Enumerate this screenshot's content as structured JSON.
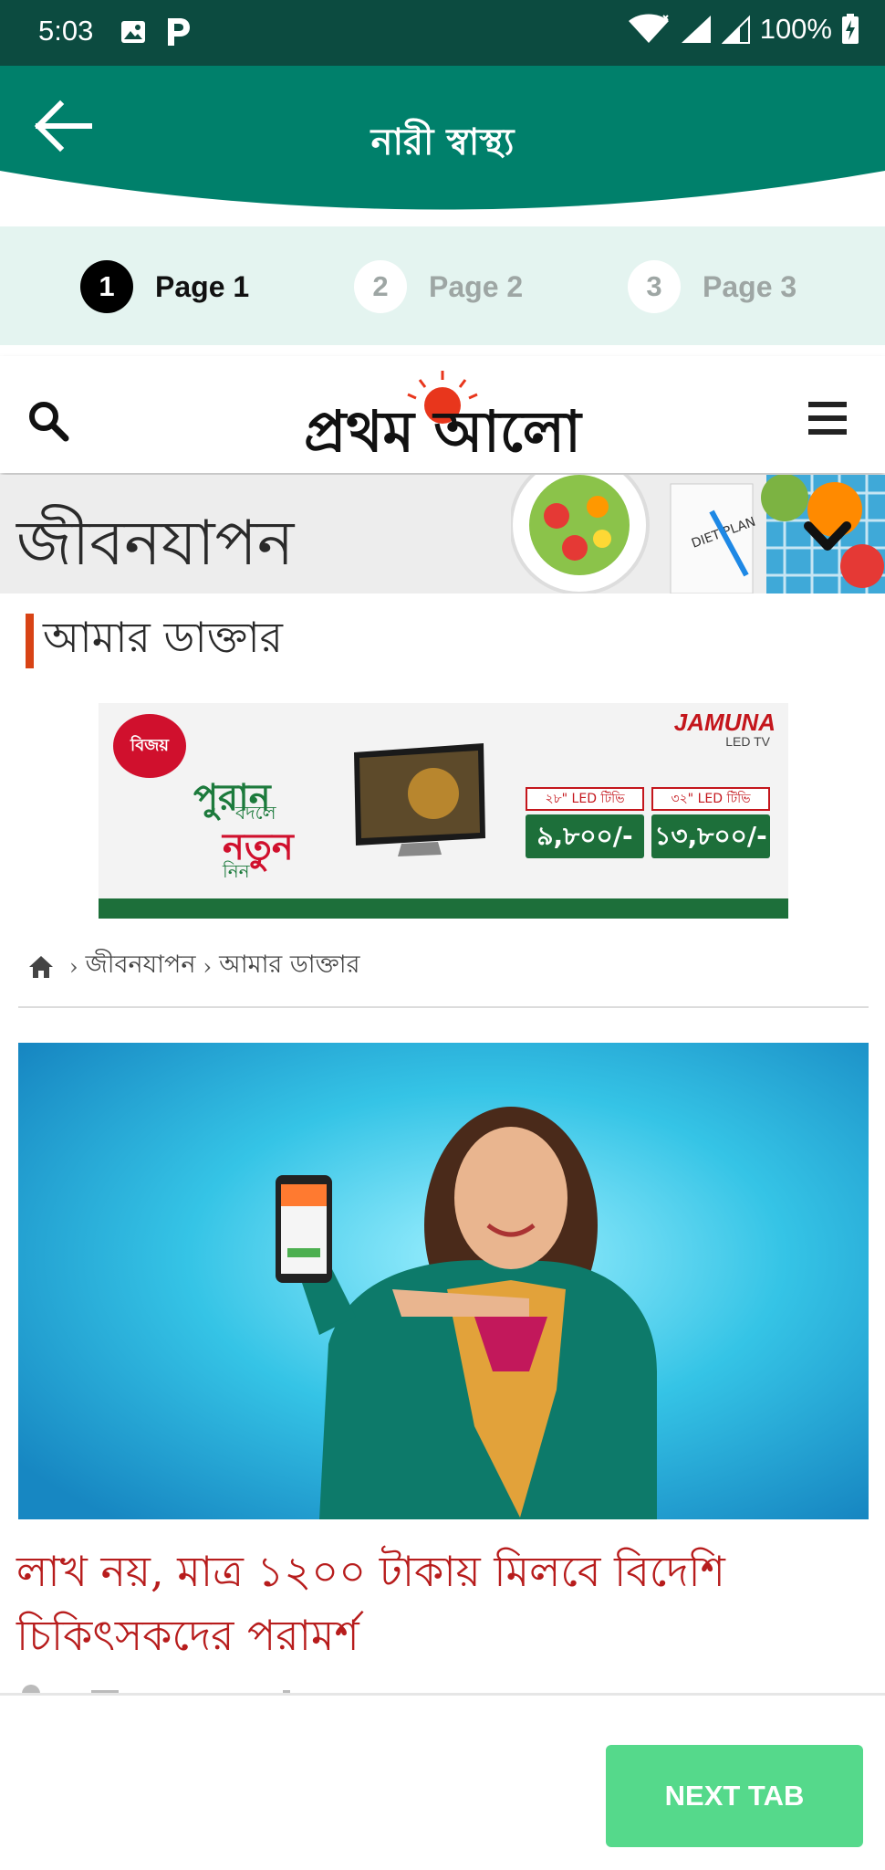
{
  "status_bar": {
    "time": "5:03",
    "battery": "100%",
    "icons": [
      "image-icon",
      "parking-icon",
      "wifi-icon",
      "signal-icon",
      "battery-charging-icon"
    ]
  },
  "app_bar": {
    "title": "নারী স্বাস্থ্য",
    "back_icon": "arrow-left-icon",
    "color": "#00806b"
  },
  "stepper": {
    "steps": [
      {
        "number": "1",
        "label": "Page 1",
        "active": true
      },
      {
        "number": "2",
        "label": "Page 2",
        "active": false
      },
      {
        "number": "3",
        "label": "Page 3",
        "active": false
      }
    ]
  },
  "site_header": {
    "logo_text": "প্রথম আলো",
    "search_icon": "search-icon",
    "menu_icon": "hamburger-menu-icon"
  },
  "section": {
    "title": "জীবনযাপন",
    "art_text": "DIET PLAN"
  },
  "subsection": {
    "title": "আমার ডাক্তার"
  },
  "ad": {
    "brand": "JAMUNA",
    "brand_sub": "LED TV",
    "badge": "বিজয়",
    "line1": "পুরান",
    "line2": "বদলে",
    "line3": "নতুন",
    "line4": "নিন",
    "offers": [
      {
        "label": "২৮\" LED টিভি",
        "price": "৯,৮০০/-"
      },
      {
        "label": "৩২\" LED টিভি",
        "price": "১৩,৮০০/-"
      }
    ]
  },
  "breadcrumb": {
    "items": [
      "জীবনযাপন",
      "আমার ডাক্তার"
    ],
    "separator": "›"
  },
  "article": {
    "headline": "লাখ নয়, মাত্র ১২০০ টাকায় মিলবে বিদেশি চিকিৎসকদের পরামর্শ"
  },
  "bottom_bar": {
    "next_label": "NEXT TAB",
    "next_color": "#55d98b"
  }
}
